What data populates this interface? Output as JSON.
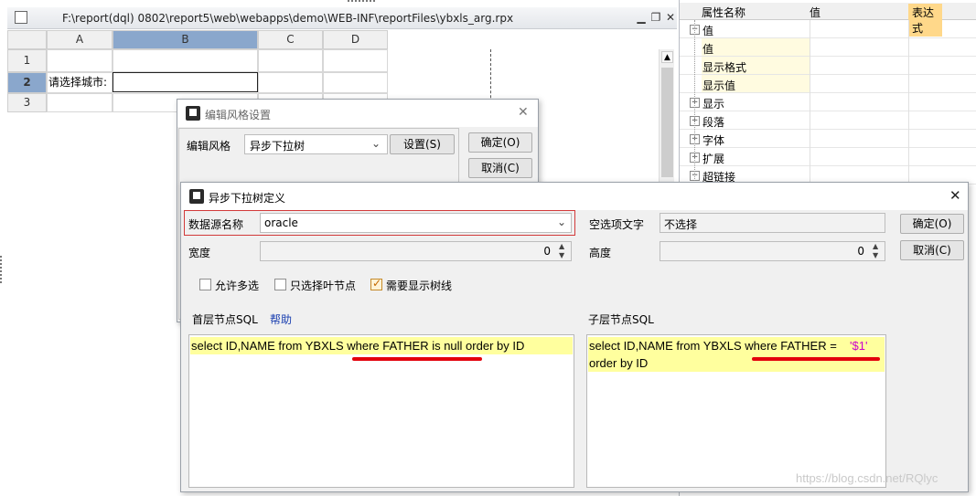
{
  "editor": {
    "title": "F:\\report(dql) 0802\\report5\\web\\webapps\\demo\\WEB-INF\\reportFiles\\ybxls_arg.rpx",
    "columns": [
      "A",
      "B",
      "C",
      "D"
    ],
    "rows": [
      "1",
      "2",
      "3"
    ],
    "cell_a2": "请选择城市:"
  },
  "props": {
    "headers": [
      "属性名称",
      "值",
      "表达式"
    ],
    "items": [
      {
        "label": "值",
        "kind": "group-open"
      },
      {
        "label": "值",
        "kind": "child"
      },
      {
        "label": "显示格式",
        "kind": "child"
      },
      {
        "label": "显示值",
        "kind": "child"
      },
      {
        "label": "显示",
        "kind": "group"
      },
      {
        "label": "段落",
        "kind": "group"
      },
      {
        "label": "字体",
        "kind": "group"
      },
      {
        "label": "扩展",
        "kind": "group"
      },
      {
        "label": "超链接",
        "kind": "group-open"
      }
    ]
  },
  "style_dialog": {
    "title": "编辑风格设置",
    "edit_style_label": "编辑风格",
    "edit_style_value": "异步下拉树",
    "setup_button": "设置(S)",
    "ok_button": "确定(O)",
    "cancel_button": "取消(C)"
  },
  "tree_dialog": {
    "title": "异步下拉树定义",
    "datasource_label": "数据源名称",
    "datasource_value": "oracle",
    "empty_text_label": "空选项文字",
    "empty_text_value": "不选择",
    "width_label": "宽度",
    "width_value": "0",
    "height_label": "高度",
    "height_value": "0",
    "ok_button": "确定(O)",
    "cancel_button": "取消(C)",
    "allow_multi": "允许多选",
    "leaf_only": "只选择叶节点",
    "show_tree_lines": "需要显示树线",
    "first_sql_label": "首层节点SQL",
    "help_link": "帮助",
    "child_sql_label": "子层节点SQL",
    "first_sql": "select ID,NAME from YBXLS where FATHER is null order by ID",
    "child_sql_line1_a": "select ID,NAME from YBXLS where FATHER =",
    "child_sql_line1_b": "'$1'",
    "child_sql_line2": "order by ID"
  },
  "watermark": "https://blog.csdn.net/RQlyc",
  "colors": {
    "highlight": "#ffff9e",
    "accent_red": "#e3000b",
    "param_magenta": "#cc00cc",
    "selected_header": "#8aa7cc"
  }
}
